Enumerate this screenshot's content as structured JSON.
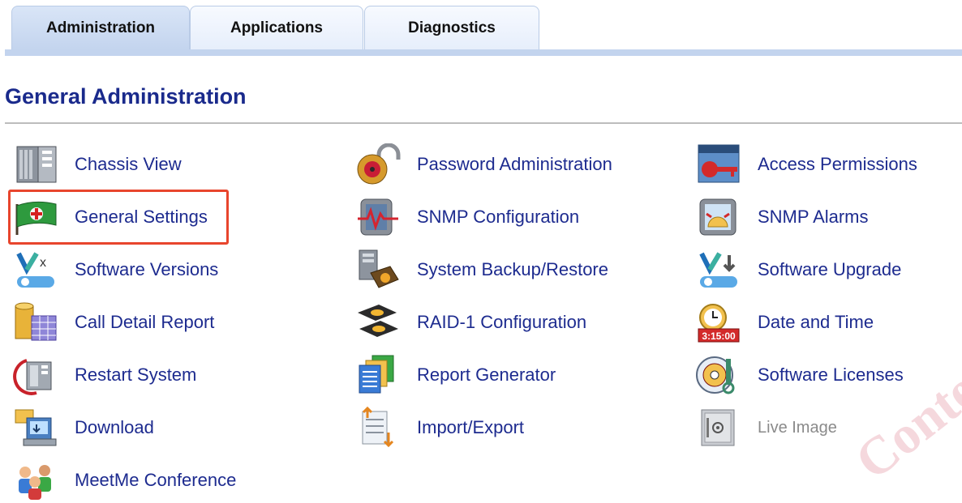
{
  "tabs": [
    {
      "label": "Administration",
      "active": true
    },
    {
      "label": "Applications",
      "active": false
    },
    {
      "label": "Diagnostics",
      "active": false
    }
  ],
  "section_title": "General Administration",
  "items": {
    "chassis_view": {
      "label": "Chassis View",
      "icon": "chassis-icon"
    },
    "general_settings": {
      "label": "General Settings",
      "icon": "settings-flag-icon",
      "highlighted": true
    },
    "software_versions": {
      "label": "Software Versions",
      "icon": "software-versions-icon"
    },
    "call_detail_report": {
      "label": "Call Detail Report",
      "icon": "database-report-icon"
    },
    "restart_system": {
      "label": "Restart System",
      "icon": "restart-icon"
    },
    "download": {
      "label": "Download",
      "icon": "download-icon"
    },
    "meetme_conference": {
      "label": "MeetMe Conference",
      "icon": "conference-icon"
    },
    "password_administration": {
      "label": "Password Administration",
      "icon": "padlock-icon"
    },
    "snmp_configuration": {
      "label": "SNMP Configuration",
      "icon": "snmp-config-icon"
    },
    "system_backup_restore": {
      "label": "System Backup/Restore",
      "icon": "backup-icon"
    },
    "raid_configuration": {
      "label": "RAID-1 Configuration",
      "icon": "raid-disks-icon"
    },
    "report_generator": {
      "label": "Report Generator",
      "icon": "report-generator-icon"
    },
    "import_export": {
      "label": "Import/Export",
      "icon": "import-export-icon"
    },
    "access_permissions": {
      "label": "Access Permissions",
      "icon": "key-icon"
    },
    "snmp_alarms": {
      "label": "SNMP Alarms",
      "icon": "alarm-icon"
    },
    "software_upgrade": {
      "label": "Software Upgrade",
      "icon": "upgrade-icon"
    },
    "date_and_time": {
      "label": "Date and Time",
      "icon": "clock-icon",
      "clock_text": "3:15:00"
    },
    "software_licenses": {
      "label": "Software Licenses",
      "icon": "license-cd-icon"
    },
    "live_image": {
      "label": "Live Image",
      "icon": "safe-icon",
      "disabled": true
    }
  },
  "watermark": "Content",
  "colors": {
    "link": "#1d2b8f",
    "title": "#1a2a8c",
    "highlight": "#e8452d",
    "tab": "#c3d4ee"
  }
}
